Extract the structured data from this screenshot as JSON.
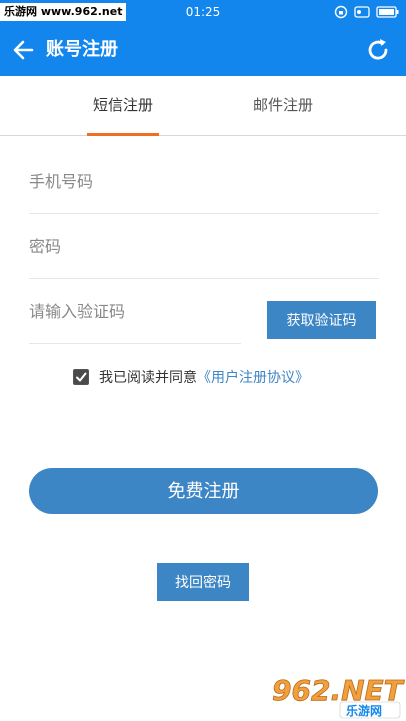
{
  "status_bar": {
    "watermark": "乐游网 www.962.net",
    "time": "01:25"
  },
  "app_bar": {
    "title": "账号注册",
    "back_icon": "arrow-left-icon",
    "refresh_icon": "refresh-icon"
  },
  "tabs": [
    {
      "label": "短信注册",
      "active": true
    },
    {
      "label": "邮件注册",
      "active": false
    }
  ],
  "form": {
    "phone_placeholder": "手机号码",
    "password_placeholder": "密码",
    "code_placeholder": "请输入验证码",
    "get_code_label": "获取验证码",
    "agreement_text": "我已阅读并同意",
    "agreement_link": "《用户注册协议》",
    "agreement_checked": true,
    "register_label": "免费注册",
    "find_password_label": "找回密码"
  },
  "brand": {
    "logo_text": "962.NET",
    "logo_subtext": "乐游网"
  },
  "colors": {
    "primary": "#1386ee",
    "button": "#3d86c6",
    "tab_indicator": "#f06e22"
  }
}
